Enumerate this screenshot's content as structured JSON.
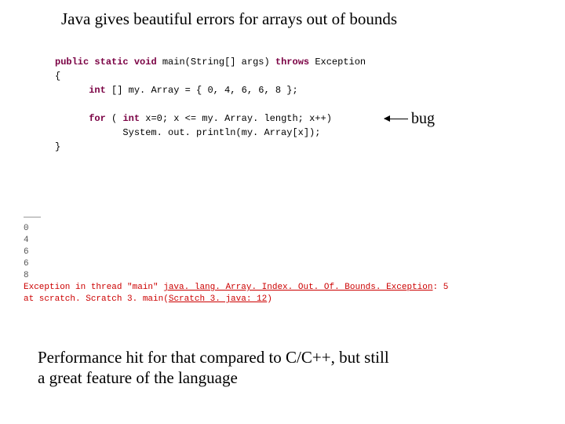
{
  "title": "Java gives beautiful errors for arrays out of bounds",
  "code": {
    "kw_public": "public",
    "kw_static": "static",
    "kw_void": "void",
    "sig_rest": " main(String[] args) ",
    "kw_throws": "throws",
    "sig_tail": " Exception",
    "brace_open": "{",
    "kw_int": "int",
    "arr_decl": "[] my. Array = { 0,  4, 6, 6, 8 };",
    "kw_for": "for",
    "for_open": "( ",
    "kw_int2": "int",
    "for_rest": " x=0; x <= my. Array. length; x++)",
    "println": "System. out. println(my. Array[x]);",
    "brace_close": "}"
  },
  "bug_label": "bug",
  "output": {
    "v0": "0",
    "v1": "4",
    "v2": "6",
    "v3": "6",
    "v4": "8",
    "exc_prefix": "Exception in thread \"main\" ",
    "exc_class": "java. lang. Array. Index. Out. Of. Bounds. Exception",
    "exc_suffix": ": 5",
    "at_indent": "       at scratch. Scratch 3. main(",
    "at_link": "Scratch 3. java: 12",
    "at_tail": ")"
  },
  "footer_l1": "Performance hit for that compared to C/C++, but still",
  "footer_l2": "a great feature of the language"
}
